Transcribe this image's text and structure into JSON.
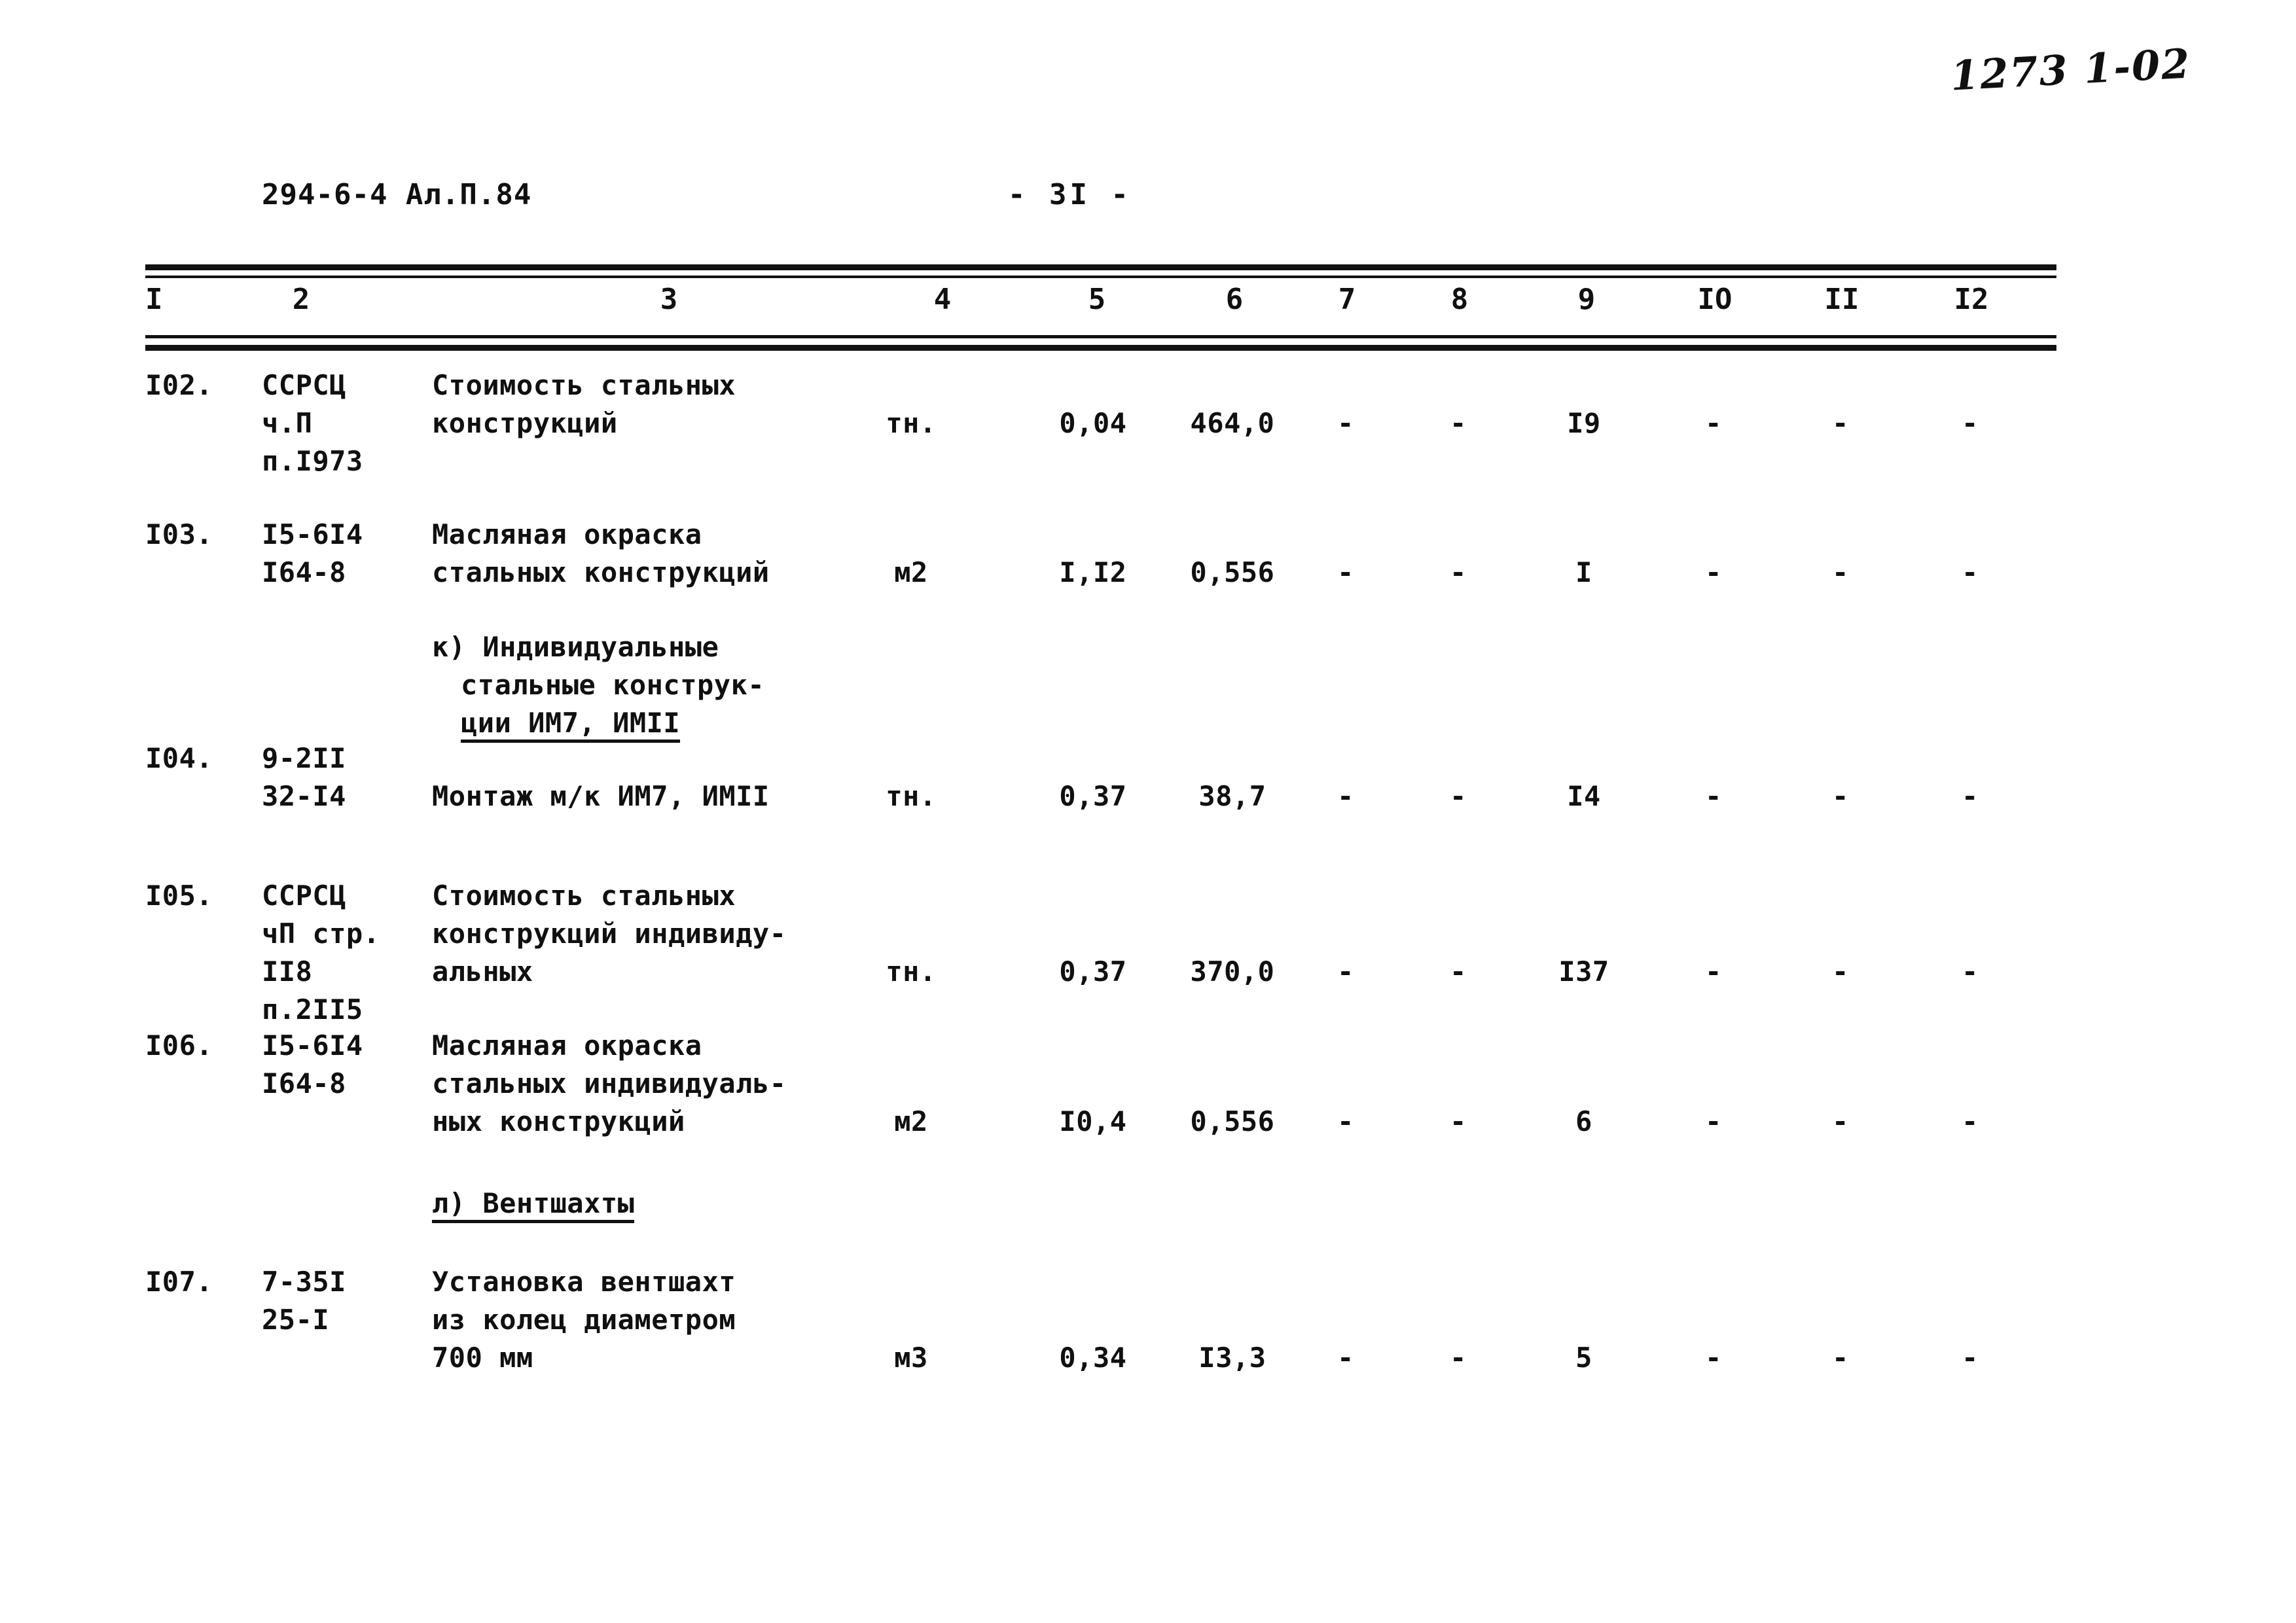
{
  "archive_mark": "1273 1-02",
  "header": {
    "doc_code": "294-6-4  Ал.П.84",
    "page_number": "-  3I  -"
  },
  "table": {
    "column_numbers": [
      "I",
      "2",
      "3",
      "4",
      "5",
      "6",
      "7",
      "8",
      "9",
      "IO",
      "II",
      "I2"
    ],
    "rows": [
      {
        "num": "I02.",
        "code": "ССРСЦ\nч.П\nп.I973",
        "name": "Стоимость стальных\nконструкций",
        "unit": "тн.",
        "v5": "0,04",
        "v6": "464,0",
        "v7": "-",
        "v8": "-",
        "v9": "I9",
        "v10": "-",
        "v11": "-",
        "v12": "-"
      },
      {
        "num": "I03.",
        "code": "I5-6I4\nI64-8",
        "name": "Масляная окраска\nстальных конструкций",
        "unit": "м2",
        "v5": "I,I2",
        "v6": "0,556",
        "v7": "-",
        "v8": "-",
        "v9": "I",
        "v10": "-",
        "v11": "-",
        "v12": "-"
      },
      {
        "num": "I04.",
        "code": "9-2II\n32-I4",
        "name": "Монтаж м/к ИМ7, ИМII",
        "unit": "тн.",
        "v5": "0,37",
        "v6": "38,7",
        "v7": "-",
        "v8": "-",
        "v9": "I4",
        "v10": "-",
        "v11": "-",
        "v12": "-"
      },
      {
        "num": "I05.",
        "code": "ССРСЦ\nчП стр.\nII8\nп.2II5",
        "name": "Стоимость стальных\nконструкций индивиду-\nальных",
        "unit": "тн.",
        "v5": "0,37",
        "v6": "370,0",
        "v7": "-",
        "v8": "-",
        "v9": "I37",
        "v10": "-",
        "v11": "-",
        "v12": "-"
      },
      {
        "num": "I06.",
        "code": "I5-6I4\nI64-8",
        "name": "Масляная окраска\nстальных индивидуаль-\nных конструкций",
        "unit": "м2",
        "v5": "I0,4",
        "v6": "0,556",
        "v7": "-",
        "v8": "-",
        "v9": "6",
        "v10": "-",
        "v11": "-",
        "v12": "-"
      },
      {
        "num": "I07.",
        "code": "7-35I\n25-I",
        "name": "Установка вентшахт\nиз колец диаметром\n700 мм",
        "unit": "м3",
        "v5": "0,34",
        "v6": "I3,3",
        "v7": "-",
        "v8": "-",
        "v9": "5",
        "v10": "-",
        "v11": "-",
        "v12": "-"
      }
    ],
    "subheadings": {
      "k_line1": "к) Индивидуальные",
      "k_line2": "стальные конструк-",
      "k_line3": "ции ИМ7, ИМII",
      "l_line1": "л) Вентшахты"
    }
  }
}
